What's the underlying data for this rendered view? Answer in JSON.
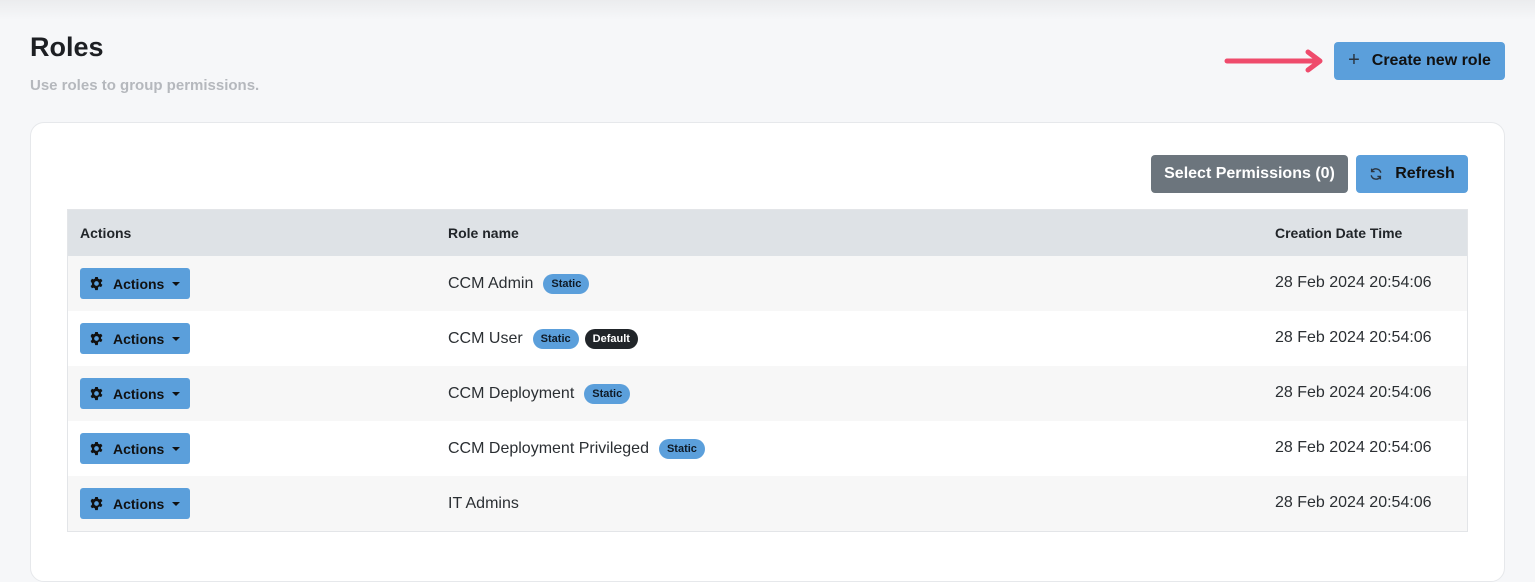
{
  "page": {
    "title": "Roles",
    "subtitle": "Use roles to group permissions."
  },
  "header": {
    "create_label": "Create new role",
    "create_icon": "plus-icon",
    "arrow_color": "#ef4b6c"
  },
  "toolbar": {
    "select_permissions_label": "Select Permissions (0)",
    "refresh_label": "Refresh",
    "refresh_icon": "refresh-icon"
  },
  "table": {
    "columns": [
      "Actions",
      "Role name",
      "Creation Date Time"
    ],
    "rows": [
      {
        "actions_label": "Actions",
        "role_name": "CCM Admin",
        "badges": [
          "Static"
        ],
        "created": "28 Feb 2024 20:54:06"
      },
      {
        "actions_label": "Actions",
        "role_name": "CCM User",
        "badges": [
          "Static",
          "Default"
        ],
        "created": "28 Feb 2024 20:54:06"
      },
      {
        "actions_label": "Actions",
        "role_name": "CCM Deployment",
        "badges": [
          "Static"
        ],
        "created": "28 Feb 2024 20:54:06"
      },
      {
        "actions_label": "Actions",
        "role_name": "CCM Deployment Privileged",
        "badges": [
          "Static"
        ],
        "created": "28 Feb 2024 20:54:06"
      },
      {
        "actions_label": "Actions",
        "role_name": "IT Admins",
        "badges": [],
        "created": "28 Feb 2024 20:54:06"
      }
    ]
  },
  "colors": {
    "primary": "#5b9fdb",
    "secondary": "#6c757d",
    "default_badge": "#212529"
  }
}
